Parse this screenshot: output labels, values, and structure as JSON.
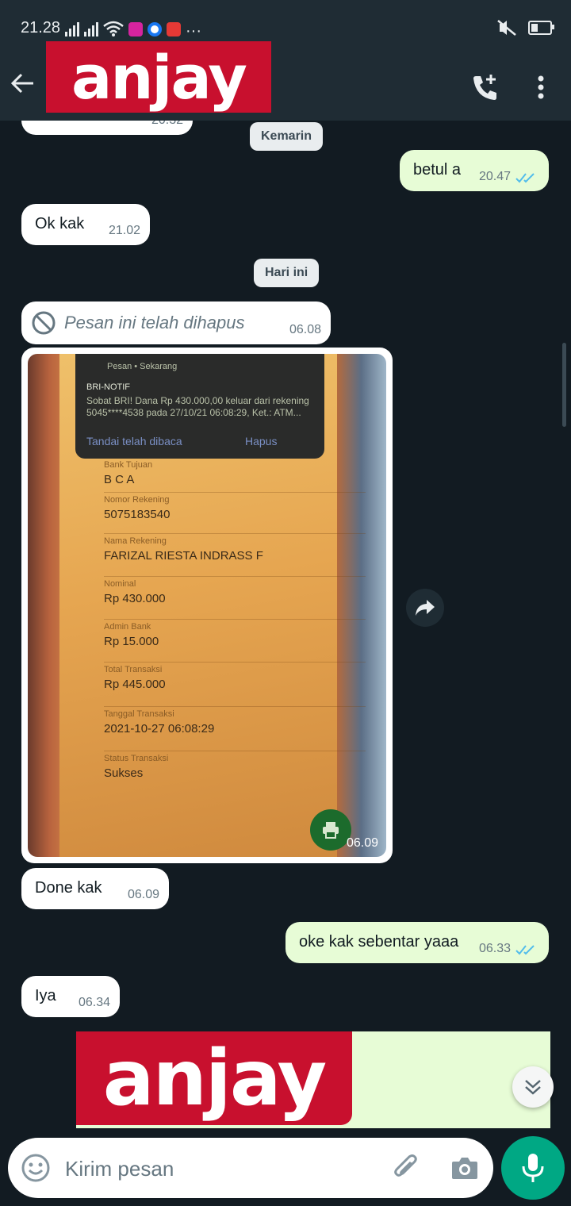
{
  "status_bar": {
    "time": "21.28",
    "dots": "···"
  },
  "header": {
    "logo_text": "anjay",
    "accent": "#1f2c34"
  },
  "messages": {
    "partial": {
      "time": "20.32"
    },
    "chip_yesterday": "Kemarin",
    "m1": {
      "text": "betul a",
      "time": "20.47"
    },
    "m2": {
      "text": "Ok kak",
      "time": "21.02"
    },
    "chip_today": "Hari ini",
    "m3": {
      "text": "Pesan ini telah dihapus",
      "time": "06.08"
    },
    "photo": {
      "time": "06.09",
      "notification": {
        "app": "Pesan • Sekarang",
        "title": "BRI-NOTIF",
        "body": "Sobat BRI! Dana Rp 430.000,00 keluar dari rekening 5045****4538 pada 27/10/21 06:08:29, Ket.: ATM...",
        "action_read": "Tandai telah dibaca",
        "action_delete": "Hapus"
      },
      "fields": {
        "bank": {
          "label": "Bank Tujuan",
          "value": "B C A"
        },
        "account_no": {
          "label": "Nomor Rekening",
          "value": "5075183540"
        },
        "account_name": {
          "label": "Nama Rekening",
          "value": "FARIZAL RIESTA INDRASS F"
        },
        "nominal": {
          "label": "Nominal",
          "value": "Rp 430.000"
        },
        "admin": {
          "label": "Admin Bank",
          "value": "Rp 15.000"
        },
        "total": {
          "label": "Total Transaksi",
          "value": "Rp 445.000"
        },
        "date": {
          "label": "Tanggal Transaksi",
          "value": "2021-10-27 06:08:29"
        },
        "status": {
          "label": "Status Transaksi",
          "value": "Sukses"
        }
      }
    },
    "m4": {
      "text": "Done kak",
      "time": "06.09"
    },
    "m5": {
      "text": "oke kak sebentar yaaa",
      "time": "06.33"
    },
    "m6": {
      "text": "Iya",
      "time": "06.34"
    }
  },
  "input": {
    "placeholder": "Kirim pesan"
  },
  "colors": {
    "background": "#121b22",
    "incoming": "#ffffff",
    "outgoing": "#e7fcd6",
    "read_ticks": "#53bdeb",
    "mic": "#00a884",
    "logo": "#c8102e"
  }
}
